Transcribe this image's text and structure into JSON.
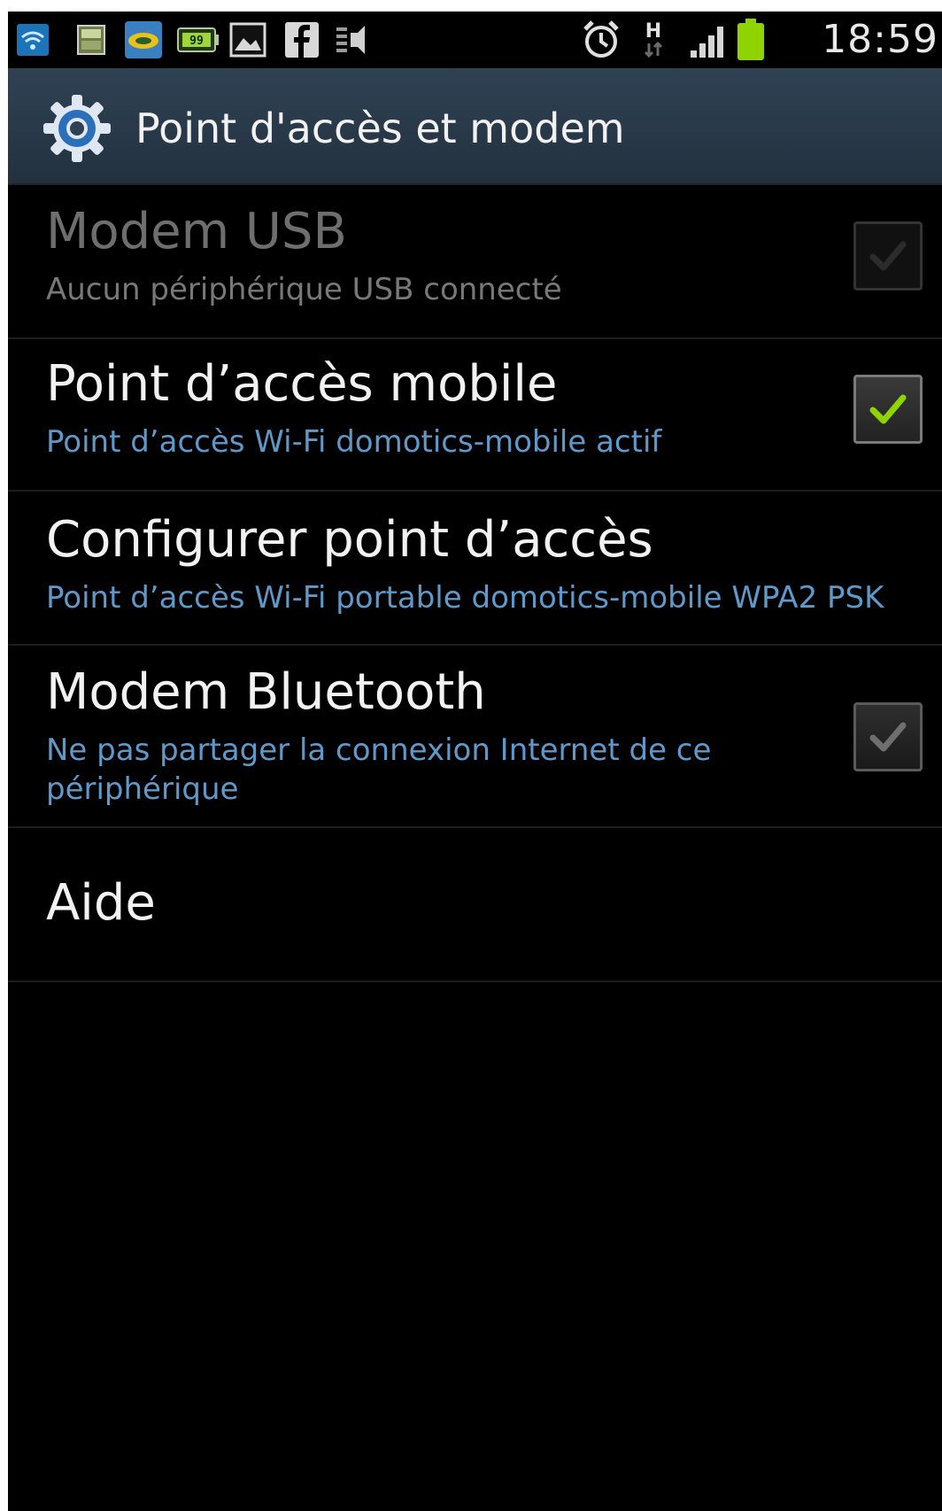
{
  "status_bar": {
    "time": "18:59",
    "network_type": "H",
    "notification_icons": [
      "wifi-icon",
      "3g-icon",
      "brand-icon",
      "battery-99-icon",
      "gallery-icon",
      "facebook-icon",
      "media-icon"
    ],
    "battery_color": "#8fd400"
  },
  "action_bar": {
    "title": "Point d'accès et modem",
    "icon": "settings-gear-icon",
    "background": "#2f4254"
  },
  "settings": [
    {
      "title": "Modem USB",
      "summary": "Aucun périphérique USB connecté",
      "enabled": false,
      "checked": false
    },
    {
      "title": "Point d’accès mobile",
      "summary": "Point d’accès Wi-Fi domotics-mobile actif",
      "enabled": true,
      "checked": true
    },
    {
      "title": "Configurer point d’accès",
      "summary": "Point d’accès Wi-Fi portable domotics-mobile WPA2 PSK",
      "enabled": true
    },
    {
      "title": "Modem Bluetooth",
      "summary": "Ne pas partager la connexion Internet de ce périphérique",
      "enabled": true,
      "checked": false
    },
    {
      "title": "Aide",
      "enabled": true
    }
  ],
  "colors": {
    "summary_blue": "#5f99c9",
    "check_green": "#8fd400"
  }
}
